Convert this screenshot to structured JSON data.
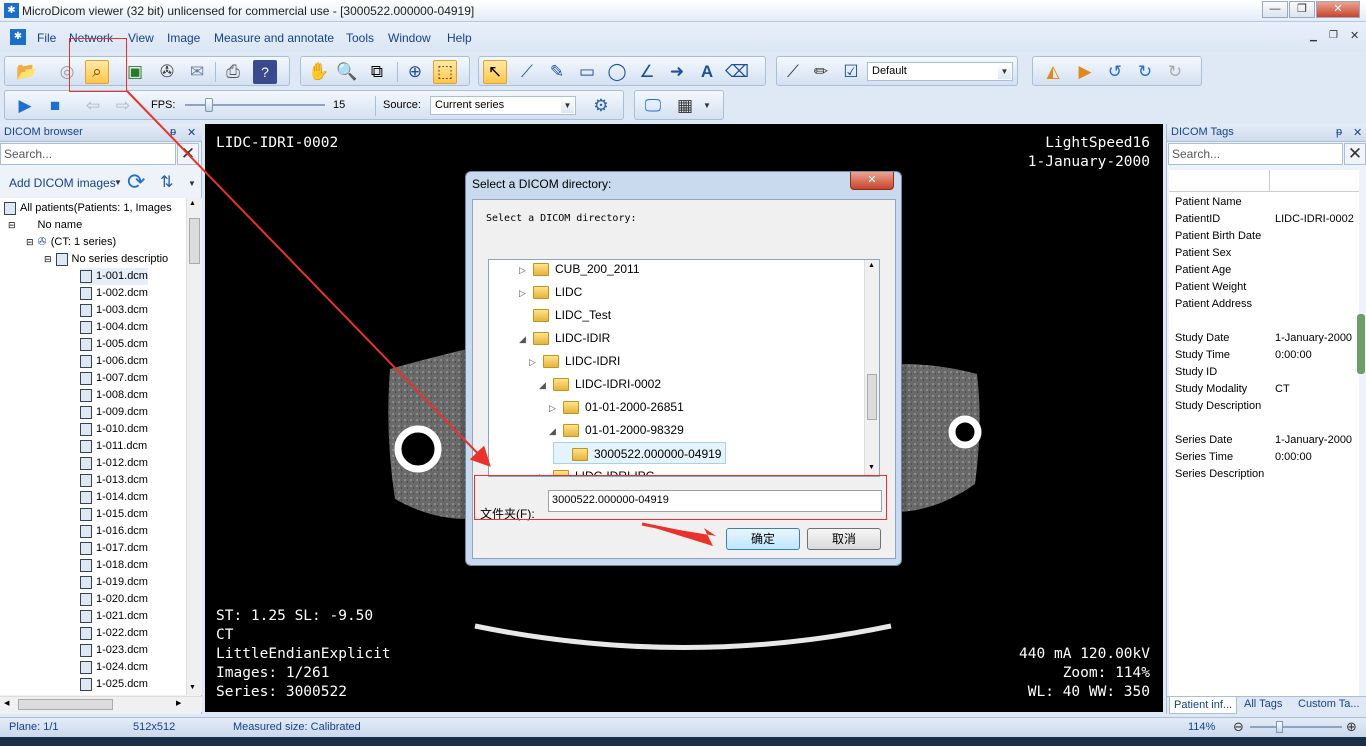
{
  "window": {
    "title": "MicroDicom viewer (32 bit) unlicensed for commercial use - [3000522.000000-04919]",
    "minimize": "—",
    "restore": "❐",
    "close": "✕"
  },
  "menu": [
    "File",
    "Network",
    "View",
    "Image",
    "Measure and annotate",
    "Tools",
    "Window",
    "Help"
  ],
  "toolbar2": {
    "fps_label": "FPS:",
    "fps_value": "15",
    "source_label": "Source:",
    "source_value": "Current series",
    "preset_value": "Default"
  },
  "browser": {
    "title": "DICOM browser",
    "pin": "ᵽ",
    "close": "✕",
    "search_placeholder": "Search...",
    "add_label": "Add DICOM images",
    "root": "All patients(Patients: 1, Images",
    "patient": "No name",
    "study": "(CT: 1 series)",
    "series": "No series descriptio",
    "files": [
      "1-001.dcm",
      "1-002.dcm",
      "1-003.dcm",
      "1-004.dcm",
      "1-005.dcm",
      "1-006.dcm",
      "1-007.dcm",
      "1-008.dcm",
      "1-009.dcm",
      "1-010.dcm",
      "1-011.dcm",
      "1-012.dcm",
      "1-013.dcm",
      "1-014.dcm",
      "1-015.dcm",
      "1-016.dcm",
      "1-017.dcm",
      "1-018.dcm",
      "1-019.dcm",
      "1-020.dcm",
      "1-021.dcm",
      "1-022.dcm",
      "1-023.dcm",
      "1-024.dcm",
      "1-025.dcm"
    ]
  },
  "overlay": {
    "top_left": "LIDC-IDRI-0002",
    "top_right_1": "LightSpeed16",
    "top_right_2": "1-January-2000",
    "bottom_left": [
      "ST: 1.25 SL: -9.50",
      "CT",
      "LittleEndianExplicit",
      "Images: 1/261",
      "Series: 3000522"
    ],
    "bottom_right": [
      "440 mA 120.00kV",
      "Zoom: 114%",
      "WL: 40 WW: 350"
    ]
  },
  "dialog": {
    "title": "Select a DICOM directory:",
    "close": "✕",
    "prompt": "Select a DICOM directory:",
    "tree": [
      {
        "label": "CUB_200_2011",
        "arrow": "▷",
        "level": 0
      },
      {
        "label": "LIDC",
        "arrow": "▷",
        "level": 0
      },
      {
        "label": "LIDC_Test",
        "arrow": "",
        "level": 0
      },
      {
        "label": "LIDC-IDIR",
        "arrow": "◢",
        "level": 0
      },
      {
        "label": "LIDC-IDRI",
        "arrow": "▷",
        "level": 1
      },
      {
        "label": "LIDC-IDRI-0002",
        "arrow": "◢",
        "level": 2
      },
      {
        "label": "01-01-2000-26851",
        "arrow": "▷",
        "level": 3
      },
      {
        "label": "01-01-2000-98329",
        "arrow": "◢",
        "level": 3
      },
      {
        "label": "3000522.000000-04919",
        "arrow": "",
        "level": 4
      },
      {
        "label": "LIDC-IDRI-IPC",
        "arrow": "▷",
        "level": 2
      }
    ],
    "folder_label": "文件夹(F):",
    "folder_value": "3000522.000000-04919",
    "ok": "确定",
    "cancel": "取消"
  },
  "tags": {
    "title": "DICOM Tags",
    "pin": "ᵽ",
    "close": "✕",
    "search_placeholder": "Search...",
    "rows": [
      {
        "k": "Patient Name",
        "v": ""
      },
      {
        "k": "PatientID",
        "v": "LIDC-IDRI-0002"
      },
      {
        "k": "Patient Birth Date",
        "v": ""
      },
      {
        "k": "Patient Sex",
        "v": ""
      },
      {
        "k": "Patient Age",
        "v": ""
      },
      {
        "k": "Patient Weight",
        "v": ""
      },
      {
        "k": "Patient Address",
        "v": ""
      },
      {
        "k": "",
        "v": ""
      },
      {
        "k": "Study Date",
        "v": "1-January-2000"
      },
      {
        "k": "Study Time",
        "v": "0:00:00"
      },
      {
        "k": "Study ID",
        "v": ""
      },
      {
        "k": "Study Modality",
        "v": "CT"
      },
      {
        "k": "Study Description",
        "v": ""
      },
      {
        "k": "",
        "v": ""
      },
      {
        "k": "Series Date",
        "v": "1-January-2000"
      },
      {
        "k": "Series Time",
        "v": "0:00:00"
      },
      {
        "k": "Series Description",
        "v": ""
      }
    ],
    "tabs": [
      "Patient inf...",
      "All Tags",
      "Custom Ta..."
    ]
  },
  "status": {
    "plane": "Plane: 1/1",
    "size": "512x512",
    "measured": "Measured size: Calibrated",
    "zoom": "114%"
  },
  "colors": {
    "annotation": "#e8322b",
    "accent": "#15428b"
  }
}
